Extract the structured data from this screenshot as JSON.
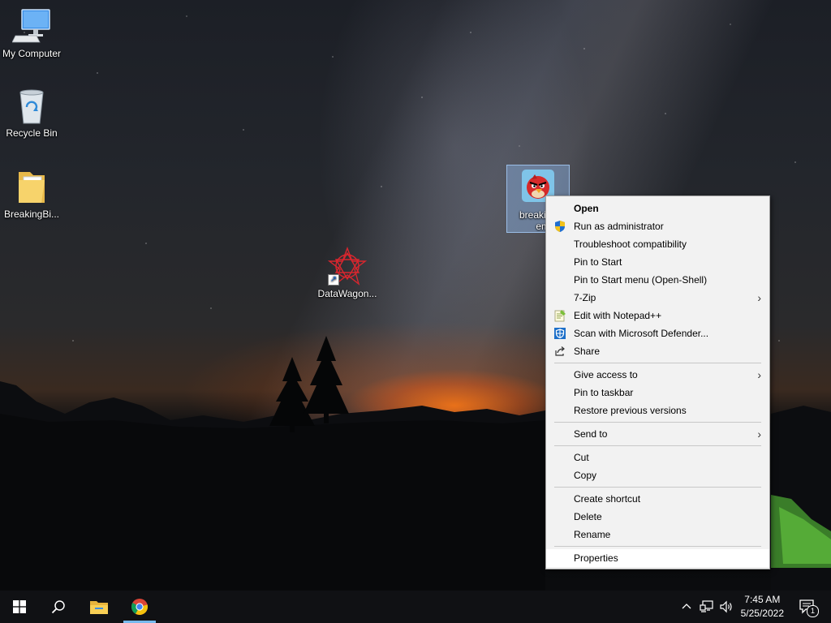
{
  "desktop": {
    "icons": [
      {
        "label": "My Computer",
        "icon": "computer-icon"
      },
      {
        "label": "Recycle Bin",
        "icon": "recycle-bin-icon"
      },
      {
        "label": "BreakingBi...",
        "icon": "folder-icon"
      },
      {
        "label": "DataWagon...",
        "icon": "datawagon-app-icon"
      },
      {
        "label_line1": "breaking",
        "label_line2": "emo",
        "icon": "angry-bird-icon"
      }
    ]
  },
  "context_menu": {
    "items": [
      {
        "label": "Open",
        "bold": true
      },
      {
        "label": "Run as administrator",
        "icon": "uac-shield-icon"
      },
      {
        "label": "Troubleshoot compatibility"
      },
      {
        "label": "Pin to Start"
      },
      {
        "label": "Pin to Start menu (Open-Shell)"
      },
      {
        "label": "7-Zip",
        "submenu": true
      },
      {
        "label": "Edit with Notepad++",
        "icon": "notepad-plus-plus-icon"
      },
      {
        "label": "Scan with Microsoft Defender...",
        "icon": "defender-icon"
      },
      {
        "label": "Share",
        "icon": "share-icon"
      },
      {
        "label": "Give access to",
        "submenu": true
      },
      {
        "label": "Pin to taskbar"
      },
      {
        "label": "Restore previous versions"
      },
      {
        "label": "Send to",
        "submenu": true
      },
      {
        "label": "Cut"
      },
      {
        "label": "Copy"
      },
      {
        "label": "Create shortcut"
      },
      {
        "label": "Delete"
      },
      {
        "label": "Rename"
      },
      {
        "label": "Properties",
        "highlighted": true
      }
    ]
  },
  "taskbar": {
    "pinned": [
      {
        "name": "start-button",
        "icon": "windows-logo-icon"
      },
      {
        "name": "search-button",
        "icon": "search-icon"
      },
      {
        "name": "file-explorer-button",
        "icon": "folder-icon"
      },
      {
        "name": "chrome-button",
        "icon": "chrome-icon",
        "active": true
      }
    ],
    "tray": {
      "icons": [
        "chevron-up-icon",
        "network-icon",
        "volume-icon"
      ],
      "time": "7:45 AM",
      "date": "5/25/2022",
      "notification_count": "1"
    }
  },
  "colors": {
    "menu_bg": "#f2f2f2",
    "taskbar_bg": "#101114",
    "selection": "#8cb4e6",
    "active_indicator": "#76b9ed"
  }
}
